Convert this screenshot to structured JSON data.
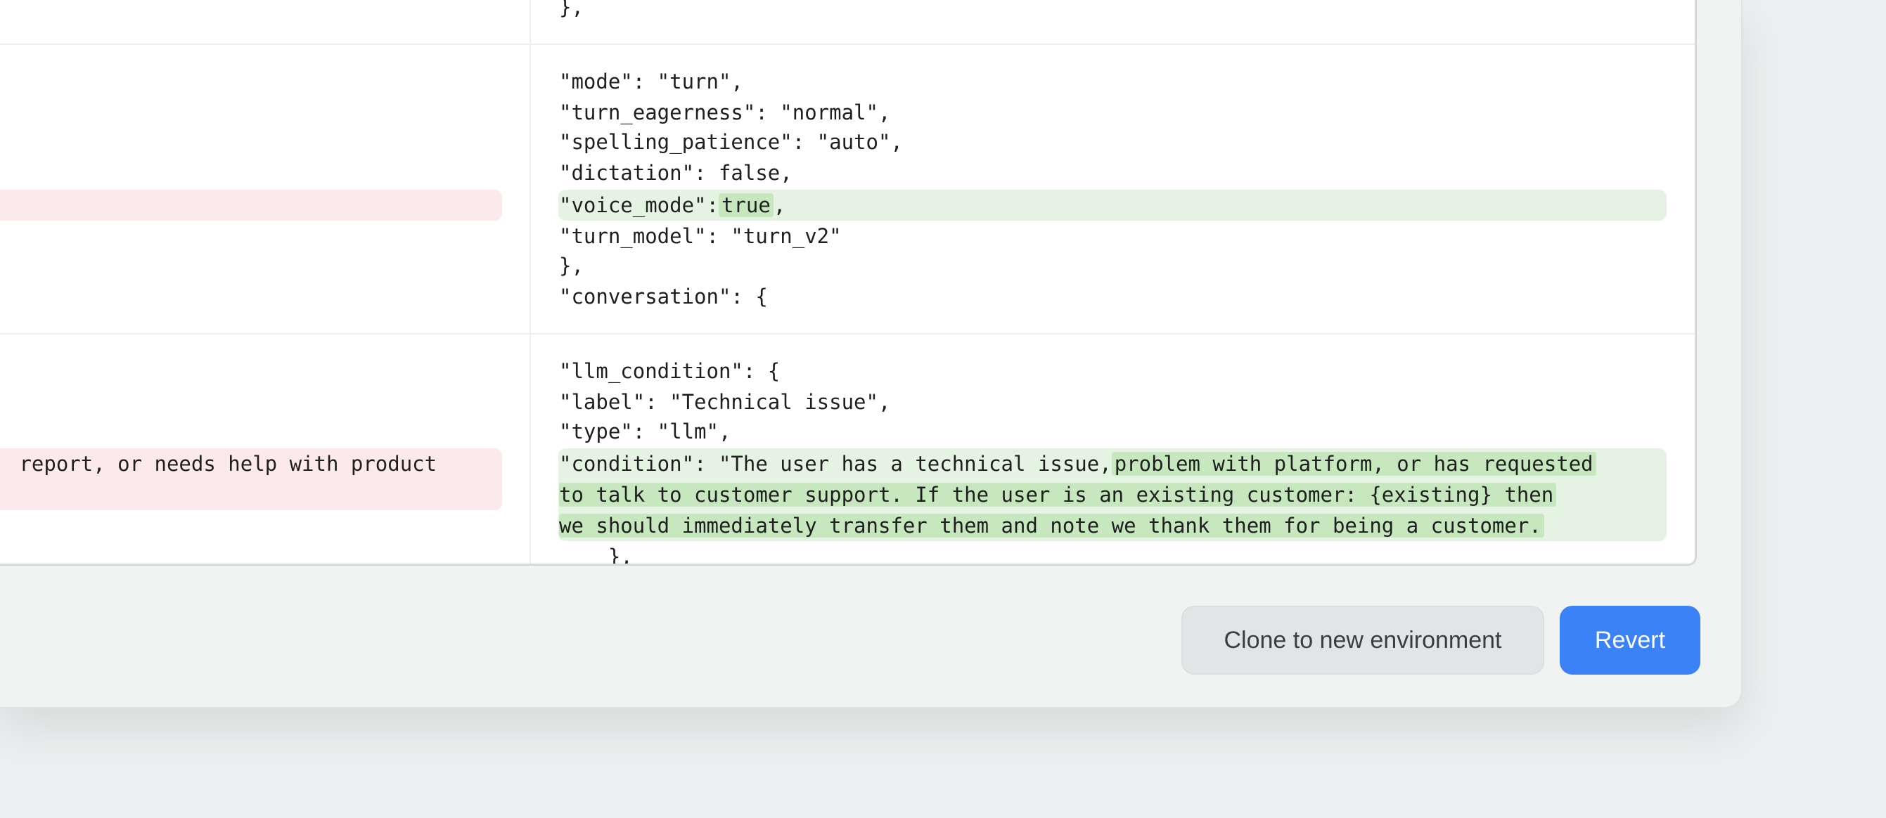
{
  "diff": {
    "top_fragment": "},",
    "block1": {
      "lines": [
        "\"mode\": \"turn\",",
        "\"turn_eagerness\": \"normal\",",
        "\"spelling_patience\": \"auto\",",
        "\"dictation\": false,"
      ],
      "voice_key": "\"voice_mode\":",
      "voice_value": "true",
      "voice_tail": ",",
      "after": [
        "\"turn_model\": \"turn_v2\"",
        "},",
        "\"conversation\": {"
      ]
    },
    "block2": {
      "lines": [
        "\"llm_condition\": {",
        "\"label\": \"Technical issue\",",
        "\"type\": \"llm\","
      ],
      "condition_prefix": "\"condition\": \"The user has a technical issue,",
      "condition_added_1": "problem with platform, or has requested",
      "condition_added_2": "to talk to customer support. If the user is an existing customer: {existing} then",
      "condition_added_3": "we should immediately transfer them and note we thank them for being a customer.",
      "closing": "    },",
      "removed_fragment": " report, or needs help with product"
    }
  },
  "actions": {
    "clone_label": "Clone to new environment",
    "revert_label": "Revert"
  },
  "colors": {
    "added_bg": "#e5f4e2",
    "added_mark": "#c7e8bf",
    "removed_bg": "#fbe9ec",
    "primary": "#3b82f6"
  }
}
